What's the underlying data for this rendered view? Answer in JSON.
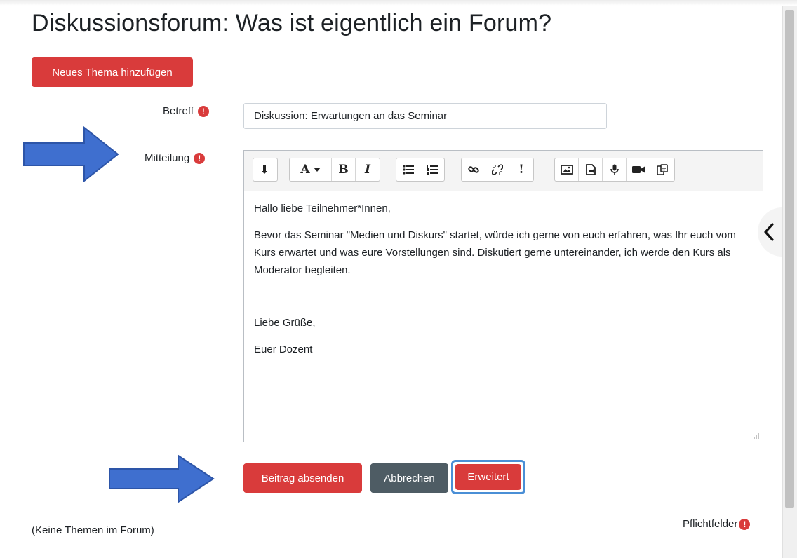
{
  "page": {
    "title": "Diskussionsforum: Was ist eigentlich ein Forum?",
    "new_topic_label": "Neues Thema hinzufügen",
    "no_topics_text": "(Keine Themen im Forum)",
    "required_fields_text": "Pflichtfelder"
  },
  "form": {
    "subject_label": "Betreff",
    "subject_value": "Diskussion: Erwartungen an das Seminar",
    "message_label": "Mitteilung",
    "message_paragraphs": [
      "Hallo liebe Teilnehmer*Innen,",
      "Bevor das Seminar \"Medien und Diskurs\" startet, würde ich gerne von euch erfahren, was Ihr euch vom Kurs erwartet und was eure Vorstellungen sind. Diskutiert gerne untereinander, ich werde den Kurs als Moderator begleiten.",
      "Liebe Grüße,",
      "Euer Dozent"
    ],
    "submit_label": "Beitrag absenden",
    "cancel_label": "Abbrechen",
    "advanced_label": "Erweitert"
  },
  "toolbar": {
    "font_label": "A",
    "bold_label": "B",
    "italic_label": "I",
    "important_label": "!"
  },
  "colors": {
    "primary_red": "#d93b3b",
    "secondary_grey": "#4e5c64",
    "arrow_blue": "#3f6fcf",
    "highlight_border": "#4a8fd6"
  }
}
